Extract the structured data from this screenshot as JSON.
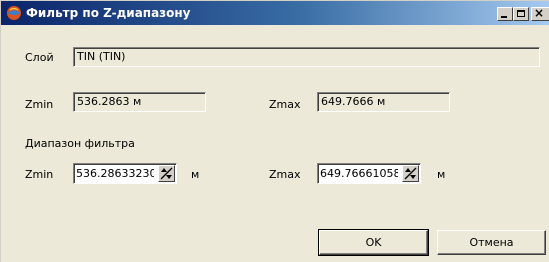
{
  "window": {
    "title": "Фильтр по Z-диапазону",
    "icon": "app-globe-icon",
    "controls": {
      "minimize": "minimize-icon",
      "maximize": "maximize-icon",
      "close": "×"
    }
  },
  "layer": {
    "label": "Слой",
    "value": "TIN (TIN)"
  },
  "range": {
    "zmin_label": "Zmin",
    "zmin_value": "536.2863 м",
    "zmax_label": "Zmax",
    "zmax_value": "649.7666 м"
  },
  "filter": {
    "section_label": "Диапазон фильтра",
    "zmin_label": "Zmin",
    "zmin_value": "536.28633230",
    "zmin_unit": "м",
    "zmax_label": "Zmax",
    "zmax_value": "649.76661058",
    "zmax_unit": "м"
  },
  "buttons": {
    "ok": "OK",
    "cancel": "Отмена"
  }
}
